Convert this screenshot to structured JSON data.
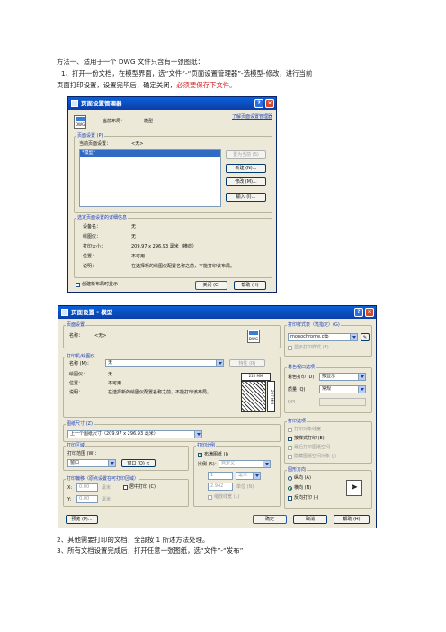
{
  "doc": {
    "heading": "方法一、适用于一个 DWG 文件只含有一张图纸：",
    "step1_a": "1、打开一份文档，在模型界面，选“文件”-“页面设置管理器”-选模型-修改，进行当前",
    "step1_b": "页面打印设置，设置完毕后，确定关闭，",
    "step1_red": "必须要保存下文件。",
    "step2": "2、其他需要打印的文档，全部按 1 所述方法处理。",
    "step3": "3、所有文档设置完成后，打开任意一张图纸，选“文件”-“发布”"
  },
  "dialog1": {
    "title": "页面设置管理器",
    "current_layout_label": "当前布局：",
    "current_layout_value": "模型",
    "help_link": "了解页面设置管理器",
    "group_page_setups": "页面设置 (P)",
    "current_setup_label": "当前页面设置：",
    "current_setup_value": "<无>",
    "list_item": "*模型*",
    "btn_set_current": "置为当前 (S)",
    "btn_new": "新建 (N)...",
    "btn_modify": "修改 (M)...",
    "btn_import": "输入 (I)...",
    "group_details": "选定页面设置的详细信息",
    "detail_labels": [
      "设备名：",
      "绘图仪：",
      "打印大小：",
      "位置：",
      "说明："
    ],
    "detail_values": [
      "无",
      "无",
      "209.97 x 296.93 毫米（横向）",
      "不可用",
      "在选择新的绘图仪配置名称之前，不能打印该布局。"
    ],
    "show_on_create": "创建新布局时显示",
    "btn_close": "关闭 (C)",
    "btn_help": "帮助 (H)"
  },
  "dialog2": {
    "title": "页面设置 - 模型",
    "group_page_setup": "页面设置",
    "name_label": "名称：",
    "name_value": "<无>",
    "group_printer": "打印机/绘图仪",
    "printer_name_label": "名称 (M)：",
    "printer_name_value": "无",
    "btn_properties": "特性 (R)",
    "plotter_label": "绘图仪：",
    "plotter_value": "无",
    "location_label": "位置：",
    "location_value": "不可用",
    "desc_label": "说明：",
    "desc_value": "在选择新的绘图仪配置名称之前，不能打印该布局。",
    "preview_dim_top": "210 MM",
    "preview_dim_side": "297 MM",
    "group_paper": "图纸尺寸 (Z)",
    "paper_value": "上一个图纸尺寸（209.97 x 296.93 毫米）",
    "group_area": "打印区域",
    "area_label": "打印范围 (W)：",
    "area_value": "窗口",
    "btn_window": "窗口 (O) <",
    "group_offset": "打印偏移（原点设置在可打印区域）",
    "x_label": "X:",
    "x_value": "0.00",
    "y_label": "Y:",
    "y_value": "0.00",
    "mm_unit": "毫米",
    "center_plot": "居中打印 (C)",
    "group_scale": "打印比例",
    "fit_paper": "布满图纸 (I)",
    "scale_label": "比例 (S)：",
    "scale_value": "自定义",
    "scale_num": "1",
    "scale_unit": "毫米",
    "scale_den": "2.942",
    "scale_unit2": "单位 (N)",
    "scale_lw": "缩放线宽 (L)",
    "group_style": "打印样式表（笔指定）(G)",
    "style_value": "monochrome.ctb",
    "show_styles": "显示打印样式 (E)",
    "group_shaded": "着色视口选项",
    "shaded_label": "着色打印 (D)",
    "shaded_value": "按显示",
    "quality_label": "质量 (Q)",
    "quality_value": "常规",
    "dpi_label": "DPI",
    "group_options": "打印选项",
    "opt1": "打印对象线宽",
    "opt2": "按样式打印 (E)",
    "opt3": "最后打印图纸空间",
    "opt4": "隐藏图纸空间对象 (J)",
    "group_orient": "图形方向",
    "portrait": "纵向 (A)",
    "landscape": "横向 (N)",
    "upside_down": "反向打印 (-)",
    "btn_preview": "预览 (P)...",
    "btn_ok": "确定",
    "btn_cancel": "取消",
    "btn_help": "帮助 (H)"
  }
}
